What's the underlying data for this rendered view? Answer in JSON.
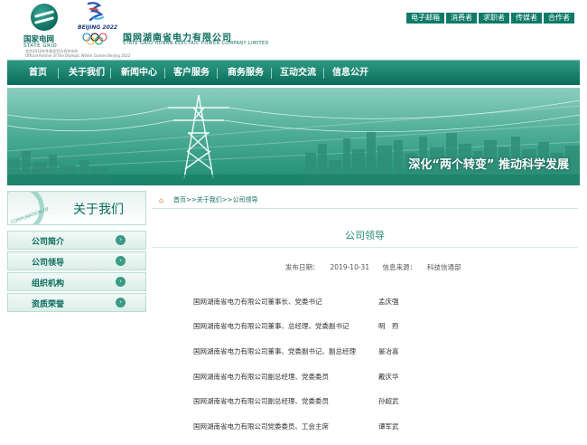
{
  "header": {
    "sgcc_cn": "国家电网",
    "sgcc_en": "STATE GRID",
    "sgcc_partner": [
      "北京2022年冬奥会官方合作伙伴",
      "Official Partner of the Olympic Winter Games Beijing 2022"
    ],
    "beijing_text": "BEIJING 2022",
    "company_cn": "国网湖南省电力有限公司",
    "company_en": "STATE GRID HUNAN ELECTRIC POWER COMPANY LIMITED",
    "top_links": [
      "电子邮箱",
      "消费者",
      "求职者",
      "传媒者",
      "合作者"
    ]
  },
  "nav": {
    "items": [
      "首页",
      "关于我们",
      "新闻中心",
      "客户服务",
      "商务服务",
      "互动交流",
      "信息公开"
    ]
  },
  "banner": {
    "slogan": "深化“两个转变” 推动科学发展"
  },
  "sidebar": {
    "title": "关于我们",
    "emblem_text": "CORPORATION OF",
    "items": [
      "公司简介",
      "公司领导",
      "组织机构",
      "资质荣誉"
    ]
  },
  "main": {
    "breadcrumb": "首页>>关于我们>>公司领导",
    "title": "公司领导",
    "publish_label": "发布日期：",
    "publish_date": "2019-10-31",
    "source_label": "信息来源：",
    "source_value": "科技信通部",
    "leaders": [
      {
        "position": "国网湖南省电力有限公司董事长、党委书记",
        "name": "孟庆强"
      },
      {
        "position": "国网湖南省电力有限公司董事、总经理、党委副书记",
        "name": "明　煦"
      },
      {
        "position": "国网湖南省电力有限公司董事、党委副书记、副总经理",
        "name": "晏冶喜"
      },
      {
        "position": "国网湖南省电力有限公司副总经理、党委委员",
        "name": "戴庆华"
      },
      {
        "position": "国网湖南省电力有限公司副总经理、党委委员",
        "name": "孙超武"
      },
      {
        "position": "国网湖南省电力有限公司党委委员、工会主席",
        "name": "谭军武"
      }
    ]
  },
  "colors": {
    "brand": "#0b6c5c",
    "nav_top": "#2d9a82",
    "accent": "#2a8a74"
  }
}
